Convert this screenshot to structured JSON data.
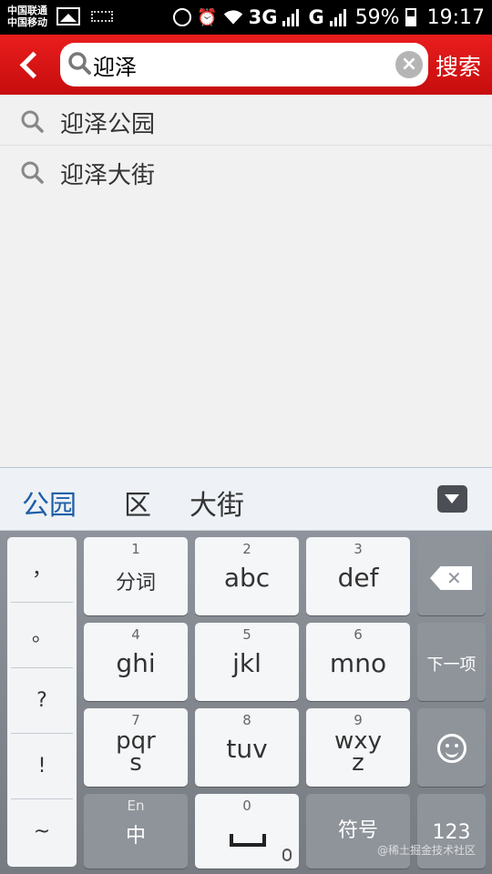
{
  "status_bar": {
    "carrier_1": "中国联通",
    "carrier_2": "中国移动",
    "network_1": "3G",
    "network_2": "G",
    "battery": "59%",
    "time": "19:17"
  },
  "header": {
    "query": "迎泽",
    "search_label": "搜索"
  },
  "suggestions": [
    {
      "text": "迎泽公园"
    },
    {
      "text": "迎泽大街"
    }
  ],
  "candidates": [
    "公园",
    "区",
    "大街"
  ],
  "keyboard": {
    "punctuation": [
      "，",
      "。",
      "?",
      "!",
      "~"
    ],
    "keys": [
      {
        "num": "1",
        "label": "分词"
      },
      {
        "num": "2",
        "label": "abc"
      },
      {
        "num": "3",
        "label": "def"
      },
      {
        "num": "4",
        "label": "ghi"
      },
      {
        "num": "5",
        "label": "jkl"
      },
      {
        "num": "6",
        "label": "mno"
      },
      {
        "num": "7",
        "label": "pqr",
        "label2": "s"
      },
      {
        "num": "8",
        "label": "tuv"
      },
      {
        "num": "9",
        "label": "wxy",
        "label2": "z"
      }
    ],
    "next_label": "下一项",
    "lang_small": "En",
    "lang_main": "中",
    "space_num": "0",
    "symbols_label": "符号",
    "numbers_label": "123"
  },
  "watermark": "@稀土掘金技术社区",
  "colors": {
    "header_red": "#d91515",
    "candidate_blue": "#1f5fa8"
  }
}
